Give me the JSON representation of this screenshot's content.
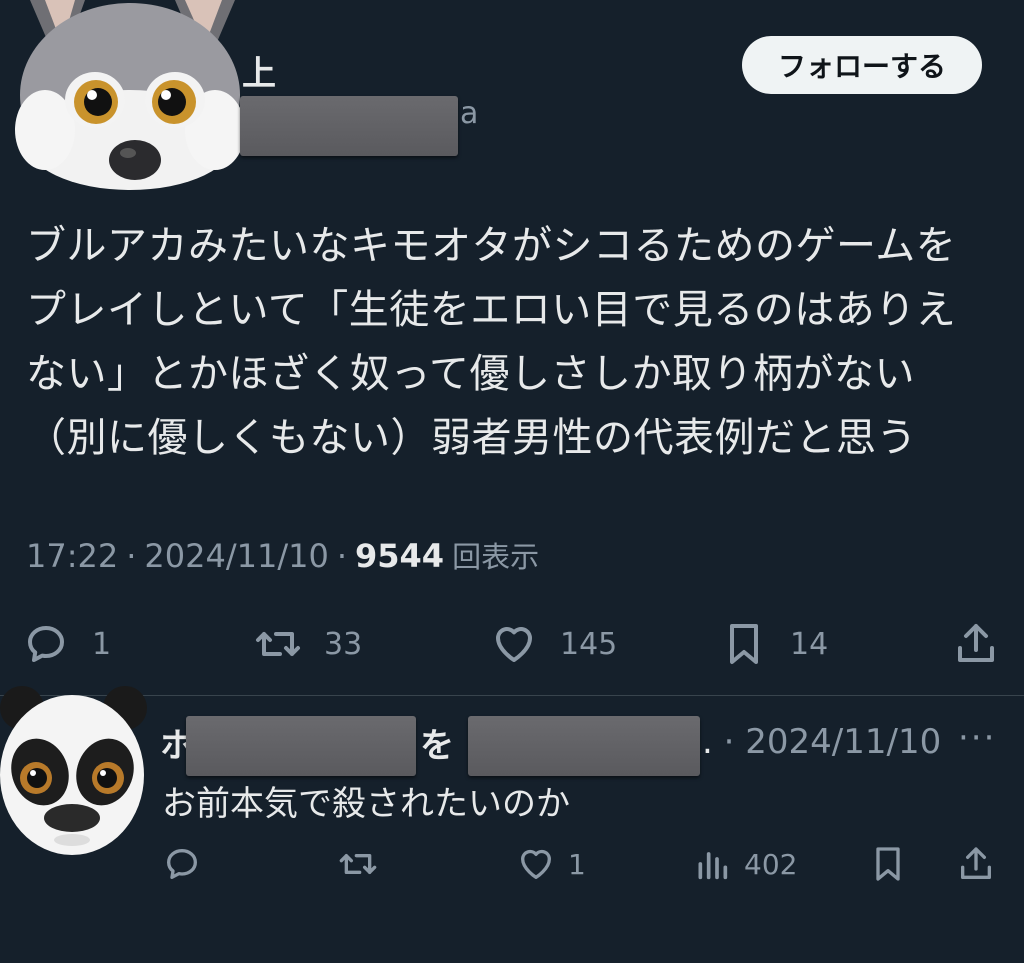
{
  "tweet": {
    "author": {
      "display_name_visible": "上",
      "handle_visible": "a",
      "avatar": "gray-wolf-avatar"
    },
    "follow_button": "フォローする",
    "text": "ブルアカみたいなキモオタがシコるためのゲームを\nプレイしといて「生徒をエロい目で見るのはありえ\nない」とかほざく奴って優しさしか取り柄がない\n（別に優しくもない）弱者男性の代表例だと思う",
    "time": "17:22",
    "sep1": "·",
    "date": "2024/11/10",
    "sep2": "·",
    "views_count": "9544",
    "views_label": "回表示",
    "actions": {
      "reply_count": "1",
      "retweet_count": "33",
      "like_count": "145",
      "bookmark_count": "14"
    }
  },
  "reply": {
    "author": {
      "name_start": "ホ",
      "name_mid": "を",
      "handle_tail": ".",
      "avatar": "panda-avatar"
    },
    "sep": "·",
    "date": "2024/11/10",
    "more": "···",
    "text": "お前本気で殺されたいのか",
    "actions": {
      "like_count": "1",
      "views_count": "402"
    }
  },
  "colors": {
    "background": "#15202b",
    "text": "#e7e9ea",
    "muted": "#8b98a5",
    "follow_bg": "#eff3f4"
  }
}
